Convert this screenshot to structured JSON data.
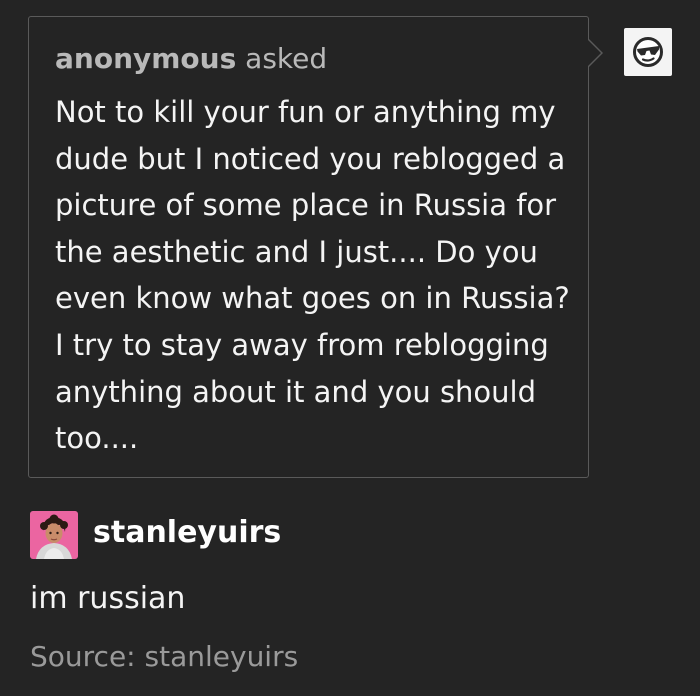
{
  "ask": {
    "asker_name": "anonymous",
    "asked_label": "asked",
    "lines": [
      "Not to kill your fun or anything my",
      "dude but I noticed you reblogged a",
      "picture of some place in Russia for",
      "the aesthetic and I just.... Do you",
      "even know what goes on in Russia?",
      "I try to stay away from reblogging",
      "anything about it and you should",
      "too...."
    ],
    "asker_avatar_icon": "anonymous-sunglasses-icon"
  },
  "answer": {
    "blog_name": "stanleyuirs",
    "text": "im russian",
    "avatar_icon": "user-photo-avatar"
  },
  "source": {
    "label": "Source:",
    "blog": "stanleyuirs"
  },
  "colors": {
    "background": "#242424",
    "border": "#5a5a5a",
    "text": "#f4f4f4",
    "muted": "#9a9a9a",
    "avatar_pink": "#e85a9a"
  }
}
